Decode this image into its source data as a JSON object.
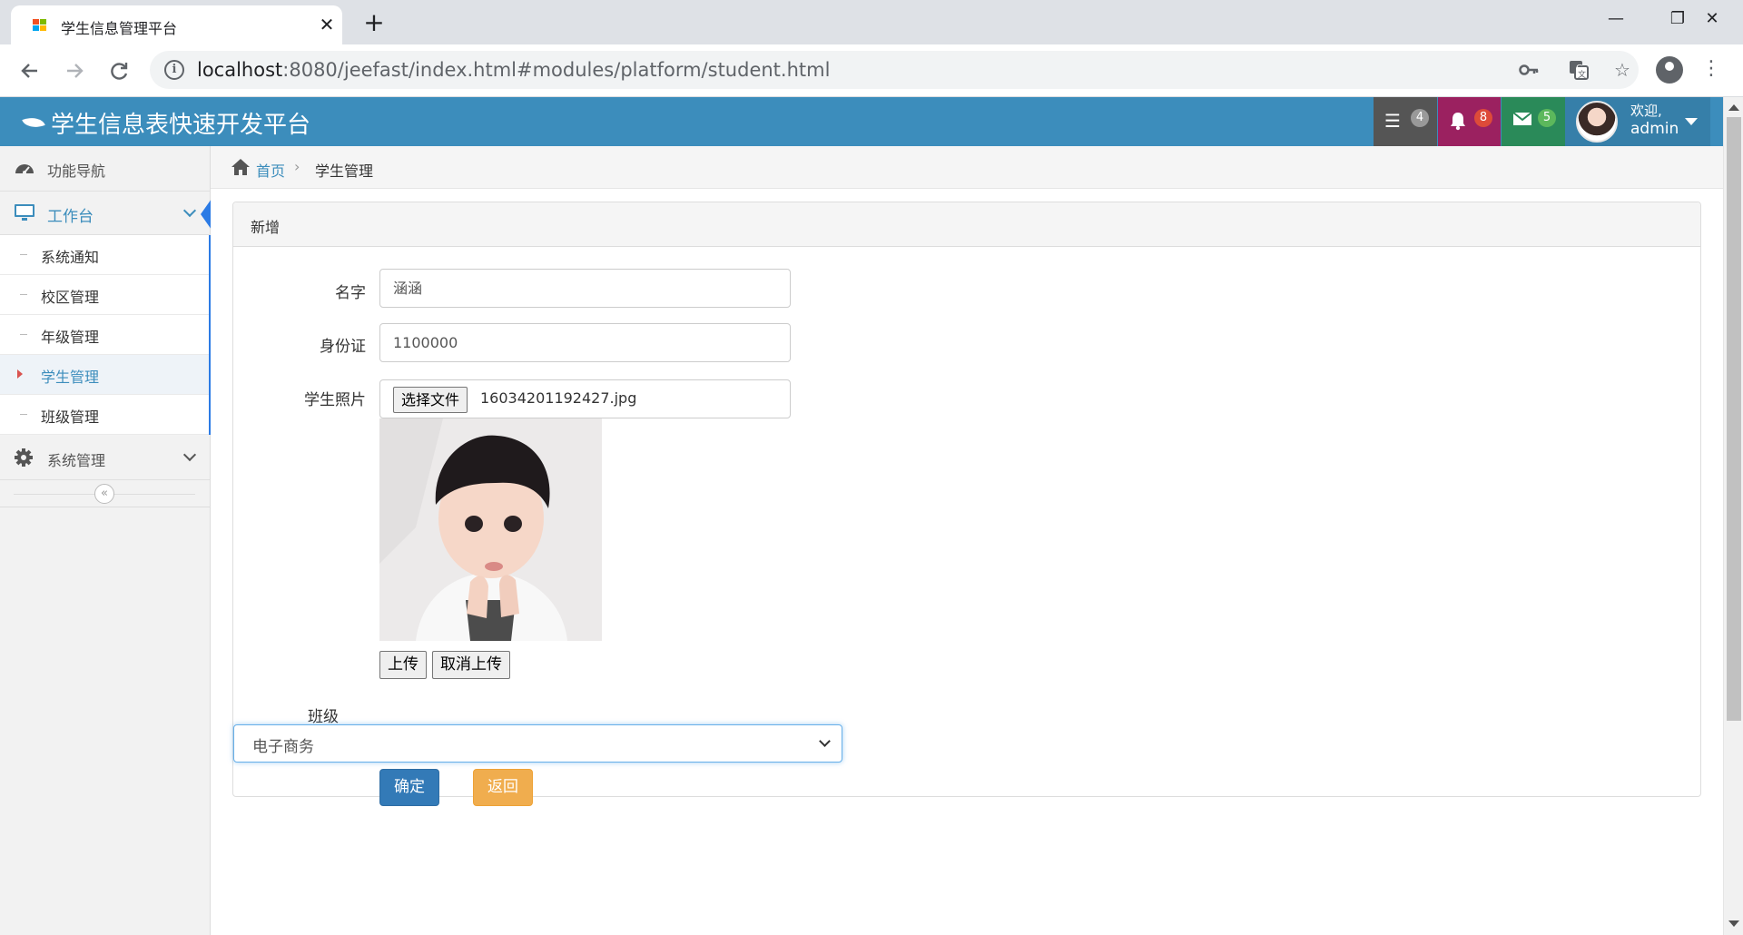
{
  "browser": {
    "tab_title": "学生信息管理平台",
    "tab_close": "✕",
    "new_tab": "+",
    "url_host": "localhost",
    "url_rest": ":8080/jeefast/index.html#modules/platform/student.html",
    "window_controls": {
      "minimize": "—",
      "restore": "❐",
      "close": "✕"
    }
  },
  "header": {
    "app_title": "学生信息表快速开发平台",
    "tasks_badge": "4",
    "notifications_badge": "8",
    "messages_badge": "5",
    "welcome": "欢迎,",
    "username": "admin",
    "colors": {
      "bar": "#3c8dbc",
      "tasks": "#555555",
      "notifications": "#9b2160",
      "messages": "#2a8a59"
    }
  },
  "sidebar": {
    "nav_label": "功能导航",
    "workbench_label": "工作台",
    "items": [
      {
        "label": "系统通知"
      },
      {
        "label": "校区管理"
      },
      {
        "label": "年级管理"
      },
      {
        "label": "学生管理"
      },
      {
        "label": "班级管理"
      }
    ],
    "system_label": "系统管理",
    "collapse_label": "«"
  },
  "breadcrumb": {
    "home": "首页",
    "separator": "›",
    "current": "学生管理"
  },
  "form": {
    "panel_title": "新增",
    "name_label": "名字",
    "name_value": "涵涵",
    "id_label": "身份证",
    "id_value": "1100000",
    "photo_label": "学生照片",
    "choose_file": "选择文件",
    "file_name": "16034201192427.jpg",
    "upload_button": "上传",
    "cancel_upload_button": "取消上传",
    "class_label": "班级",
    "class_value": "电子商务",
    "confirm_button": "确定",
    "back_button": "返回"
  }
}
